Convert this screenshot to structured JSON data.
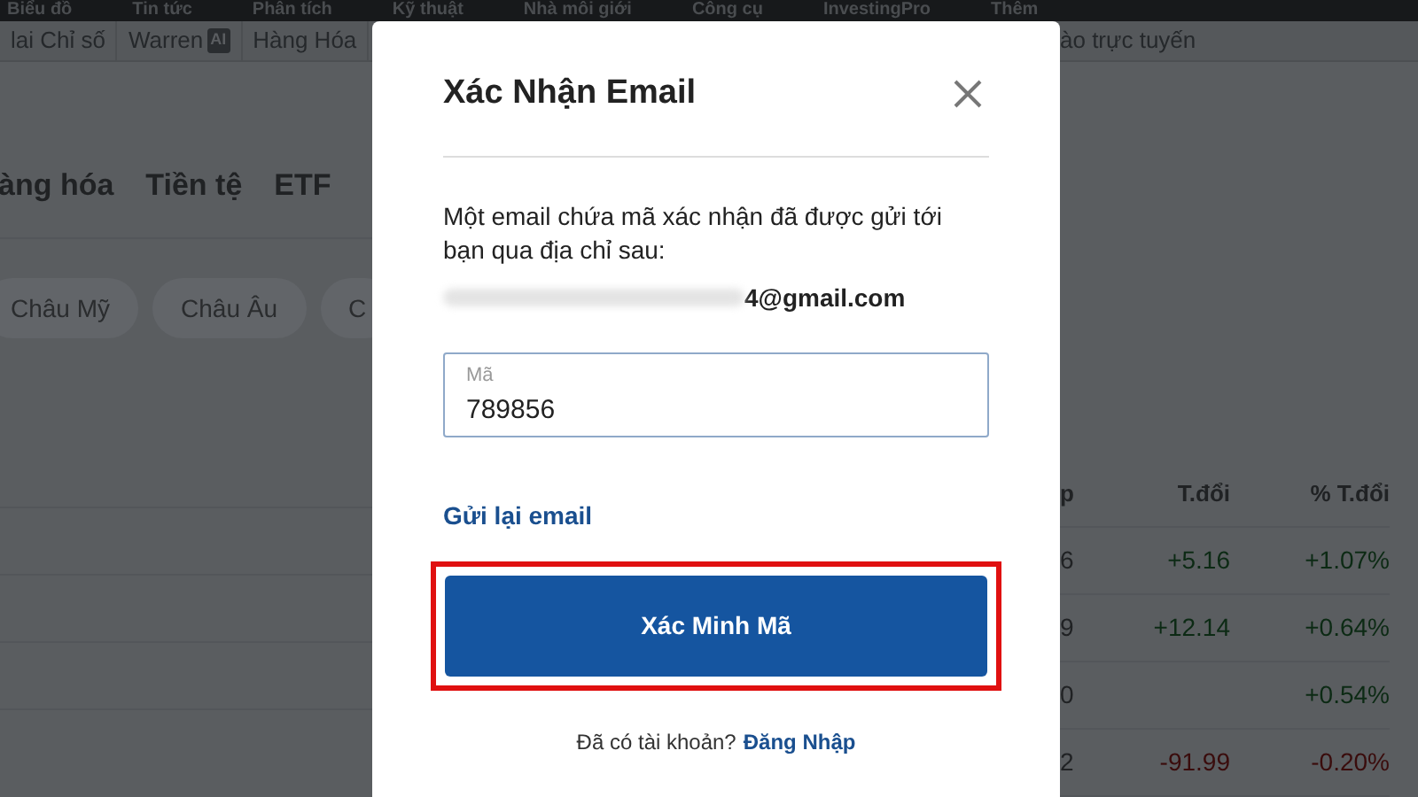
{
  "top_nav": [
    "Biểu đồ",
    "Tin tức",
    "Phân tích",
    "Kỹ thuật",
    "Nhà môi giới",
    "Công cụ",
    "InvestingPro",
    "Thêm"
  ],
  "sub_nav_left": [
    {
      "label": "lai Chỉ số"
    },
    {
      "label": "Warren",
      "badge": "AI"
    },
    {
      "label": "Hàng Hóa"
    }
  ],
  "sub_nav_right": "ào trực tuyến",
  "category_tabs": [
    "àng hóa",
    "Tiền tệ",
    "ETF"
  ],
  "region_chips": [
    "Châu Mỹ",
    "Châu Âu",
    "C"
  ],
  "table": {
    "columns": [
      "p",
      "T.đổi",
      "% T.đổi"
    ],
    "rows": [
      {
        "column_1": "6",
        "change": "+5.16",
        "percent": "+1.07%",
        "color": "#0c2a14"
      },
      {
        "column_1": "9",
        "change": "+12.14",
        "percent": "+0.64%",
        "color": "#0c2a14"
      },
      {
        "column_1": "0",
        "percent": "+0.54%",
        "color": "#0c2a14"
      },
      {
        "column_1": "2",
        "change": "-91.99",
        "percent": "-0.20%",
        "color": "#3a0c0c"
      }
    ]
  },
  "dialog": {
    "title": "Xác Nhận Email",
    "message": "Một email chứa mã xác nhận đã được gửi tới bạn qua địa chỉ sau:",
    "email": "4@gmail.com",
    "email_redacted": true,
    "code_field": {
      "label": "Mã",
      "value": "789856"
    },
    "resend_link": "Gửi lại email",
    "submit": {
      "label": "Xác Minh Mã",
      "highlighted": true
    },
    "footer_text": "Đã có tài khoản?",
    "footer_link": "Đăng Nhập"
  }
}
